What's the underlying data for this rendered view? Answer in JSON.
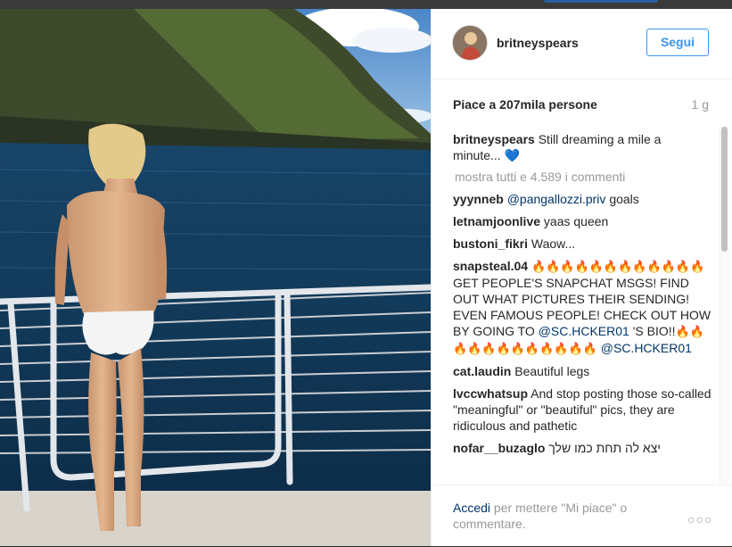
{
  "post": {
    "username": "britneyspears",
    "follow_label": "Segui",
    "likes": "Piace a 207mila persone",
    "time": "1 g",
    "caption_user": "britneyspears",
    "caption_text": "Still dreaming a mile a minute...",
    "caption_heart": "💙",
    "view_all": "mostra tutti e 4.589 i commenti"
  },
  "comments": [
    {
      "user": "yyynneb",
      "mention": "@pangallozzi.priv",
      "text": "goals"
    },
    {
      "user": "letnamjoonlive",
      "text": "yaas queen"
    },
    {
      "user": "bustoni_fikri",
      "text": "Waow..."
    },
    {
      "user": "snapsteal.04",
      "fire_pre": "🔥🔥🔥🔥🔥🔥🔥🔥🔥🔥🔥🔥",
      "text1": "GET PEOPLE'S SNAPCHAT MSGS! FIND OUT WHAT PICTURES THEIR SENDING! EVEN FAMOUS PEOPLE! CHECK OUT HOW BY GOING TO",
      "mention1": "@SC.HCKER01",
      "text2": "'S BIO!!",
      "fire_post": "🔥🔥🔥🔥🔥🔥🔥🔥🔥🔥🔥🔥",
      "mention2": "@SC.HCKER01"
    },
    {
      "user": "cat.laudin",
      "text": "Beautiful legs"
    },
    {
      "user": "lvccwhatsup",
      "text": "And stop posting those so-called \"meaningful\" or \"beautiful\" pics, they are ridiculous and pathetic"
    },
    {
      "user": "nofar__buzaglo",
      "text": "יצא לה תחת כמו שלך"
    }
  ],
  "footer": {
    "login_link": "Accedi",
    "login_text": "per mettere \"Mi piace\" o commentare.",
    "more": "○○○"
  },
  "colors": {
    "accent": "#3897f0",
    "link": "#003569",
    "muted": "#999999"
  },
  "icons": {
    "more": "ellipsis-icon"
  }
}
